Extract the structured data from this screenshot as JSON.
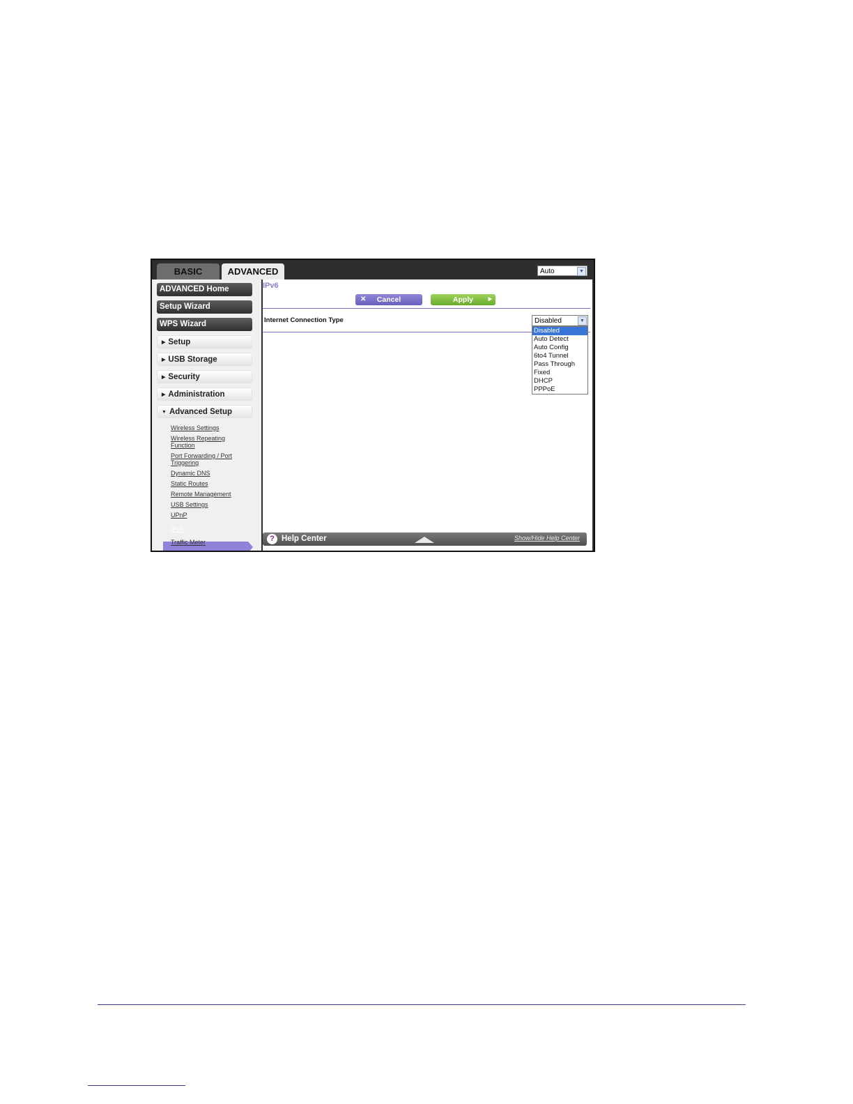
{
  "tabs": {
    "basic": "BASIC",
    "advanced": "ADVANCED"
  },
  "language_select": {
    "value": "Auto"
  },
  "sidebar": {
    "advanced_home": "ADVANCED Home",
    "setup_wizard": "Setup Wizard",
    "wps_wizard": "WPS Wizard",
    "sections": [
      {
        "label": "Setup"
      },
      {
        "label": "USB Storage"
      },
      {
        "label": "Security"
      },
      {
        "label": "Administration"
      },
      {
        "label": "Advanced Setup"
      }
    ],
    "sub_items": [
      {
        "label": "Wireless Settings"
      },
      {
        "label": "Wireless Repeating Function"
      },
      {
        "label": "Port Forwarding / Port Triggering"
      },
      {
        "label": "Dynamic DNS"
      },
      {
        "label": "Static Routes"
      },
      {
        "label": "Remote Management"
      },
      {
        "label": "USB Settings"
      },
      {
        "label": "UPnP"
      },
      {
        "label": "IPv6"
      },
      {
        "label": "Traffic Meter"
      }
    ]
  },
  "main": {
    "page_title": "IPv6",
    "cancel_label": "Cancel",
    "apply_label": "Apply",
    "connection_type_label": "Internet Connection Type",
    "connection_type_value": "Disabled",
    "connection_type_options": [
      "Disabled",
      "Auto Detect",
      "Auto Config",
      "6to4 Tunnel",
      "Pass Through",
      "Fixed",
      "DHCP",
      "PPPoE"
    ]
  },
  "help": {
    "label": "Help Center",
    "toggle": "Show/Hide Help Center"
  },
  "icons": {
    "dropdown": "chevron-down-icon",
    "cancel": "close-icon",
    "apply": "arrow-right-icon",
    "help": "question-icon",
    "collapse": "triangle-up-icon"
  },
  "colors": {
    "accent_purple": "#8f82d8",
    "apply_green": "#7ab83a",
    "selected_option": "#3875d7"
  }
}
